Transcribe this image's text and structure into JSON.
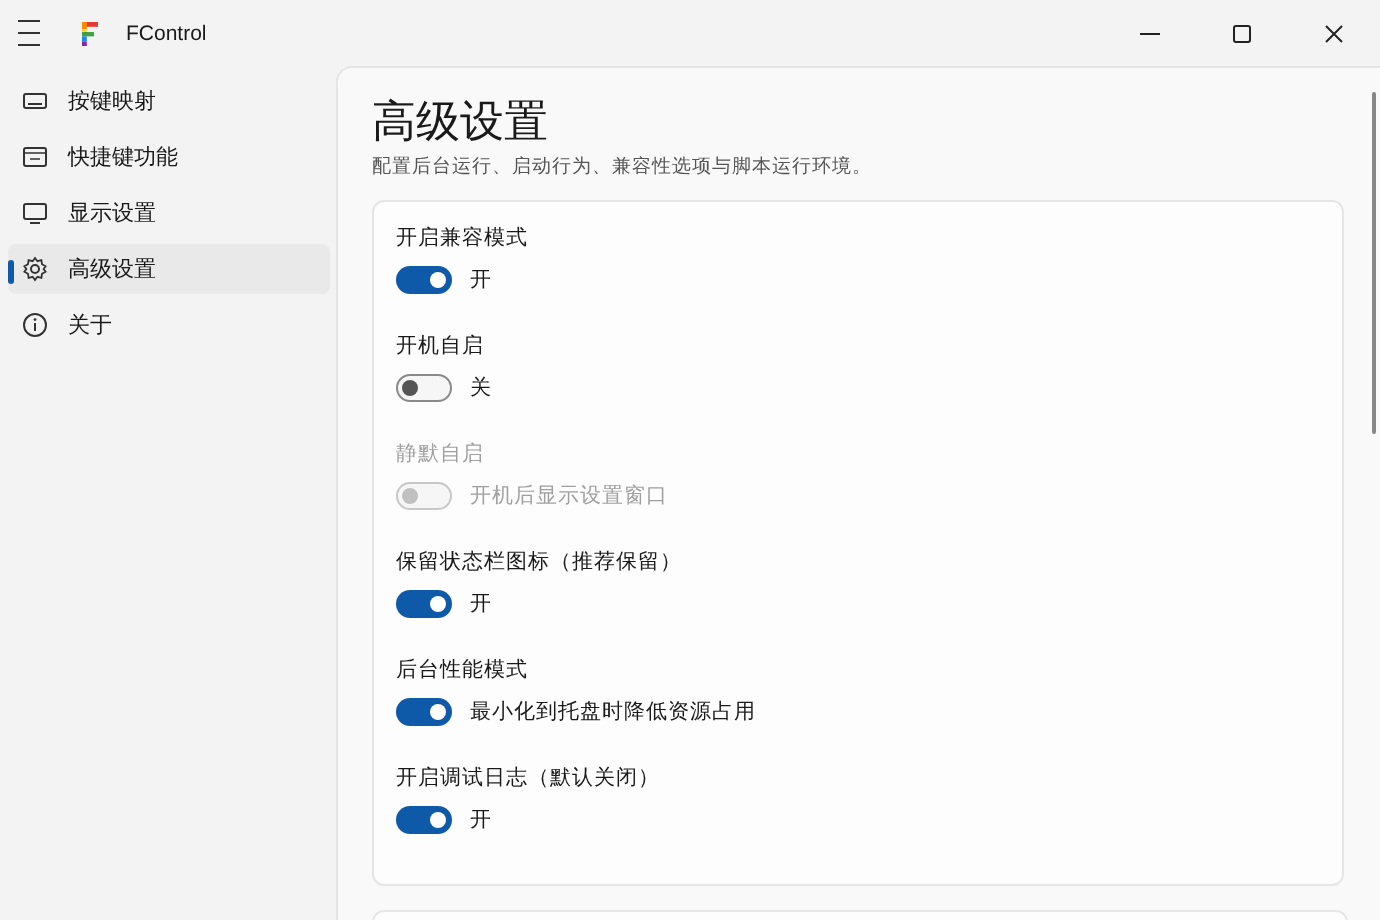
{
  "window": {
    "title": "FControl"
  },
  "sidebar": {
    "items": [
      {
        "label": "按键映射",
        "kind": "keyboard",
        "selected": false
      },
      {
        "label": "快捷键功能",
        "kind": "shortcut",
        "selected": false
      },
      {
        "label": "显示设置",
        "kind": "display",
        "selected": false
      },
      {
        "label": "高级设置",
        "kind": "settings",
        "selected": true
      },
      {
        "label": "关于",
        "kind": "about",
        "selected": false
      }
    ]
  },
  "page": {
    "title": "高级设置",
    "subtitle": "配置后台运行、启动行为、兼容性选项与脚本运行环境。"
  },
  "settings": [
    {
      "label": "开启兼容模式",
      "on": true,
      "disabled": false,
      "state_text": "开"
    },
    {
      "label": "开机自启",
      "on": false,
      "disabled": false,
      "state_text": "关"
    },
    {
      "label": "静默自启",
      "on": false,
      "disabled": true,
      "state_text": "开机后显示设置窗口"
    },
    {
      "label": "保留状态栏图标（推荐保留）",
      "on": true,
      "disabled": false,
      "state_text": "开"
    },
    {
      "label": "后台性能模式",
      "on": true,
      "disabled": false,
      "state_text": "最小化到托盘时降低资源占用"
    },
    {
      "label": "开启调试日志（默认关闭）",
      "on": true,
      "disabled": false,
      "state_text": "开"
    }
  ]
}
